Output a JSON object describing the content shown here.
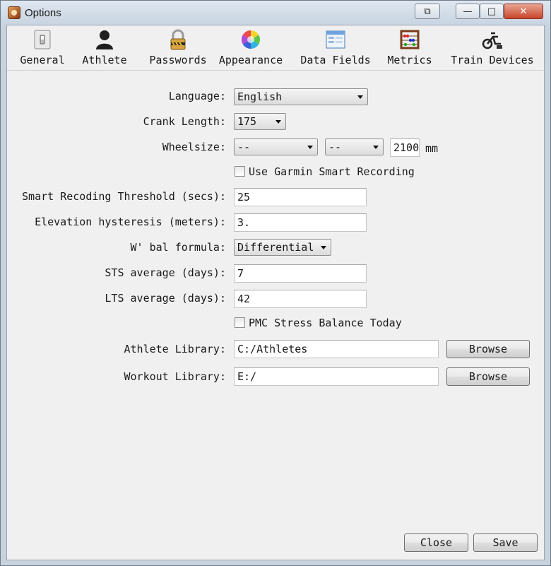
{
  "window": {
    "title": "Options"
  },
  "toolbar": {
    "items": [
      {
        "label": "General",
        "icon": "switch-icon"
      },
      {
        "label": "Athlete",
        "icon": "person-icon"
      },
      {
        "label": "Passwords",
        "icon": "padlock-icon"
      },
      {
        "label": "Appearance",
        "icon": "color-wheel-icon"
      },
      {
        "label": "Data Fields",
        "icon": "window-fields-icon"
      },
      {
        "label": "Metrics",
        "icon": "abacus-icon"
      },
      {
        "label": "Train Devices",
        "icon": "trainer-icon"
      }
    ]
  },
  "form": {
    "language": {
      "label": "Language:",
      "value": "English"
    },
    "crank": {
      "label": "Crank Length:",
      "value": "175"
    },
    "wheelsize": {
      "label": "Wheelsize:",
      "rim": "--",
      "tire": "--",
      "value": "2100",
      "unit": "mm"
    },
    "garmin": {
      "label": "Use Garmin Smart Recording",
      "checked": false
    },
    "threshold": {
      "label": "Smart Recoding Threshold (secs):",
      "value": "25"
    },
    "elevation": {
      "label": "Elevation hysteresis (meters):",
      "value": "3."
    },
    "wbal": {
      "label": "W' bal formula:",
      "value": "Differential"
    },
    "sts": {
      "label": "STS average (days):",
      "value": "7"
    },
    "lts": {
      "label": "LTS average (days):",
      "value": "42"
    },
    "pmc": {
      "label": "PMC Stress Balance Today",
      "checked": false
    },
    "athlete_library": {
      "label": "Athlete Library:",
      "value": "C:/Athletes",
      "button": "Browse"
    },
    "workout_library": {
      "label": "Workout Library:",
      "value": "E:/",
      "button": "Browse"
    }
  },
  "footer": {
    "close": "Close",
    "save": "Save"
  }
}
